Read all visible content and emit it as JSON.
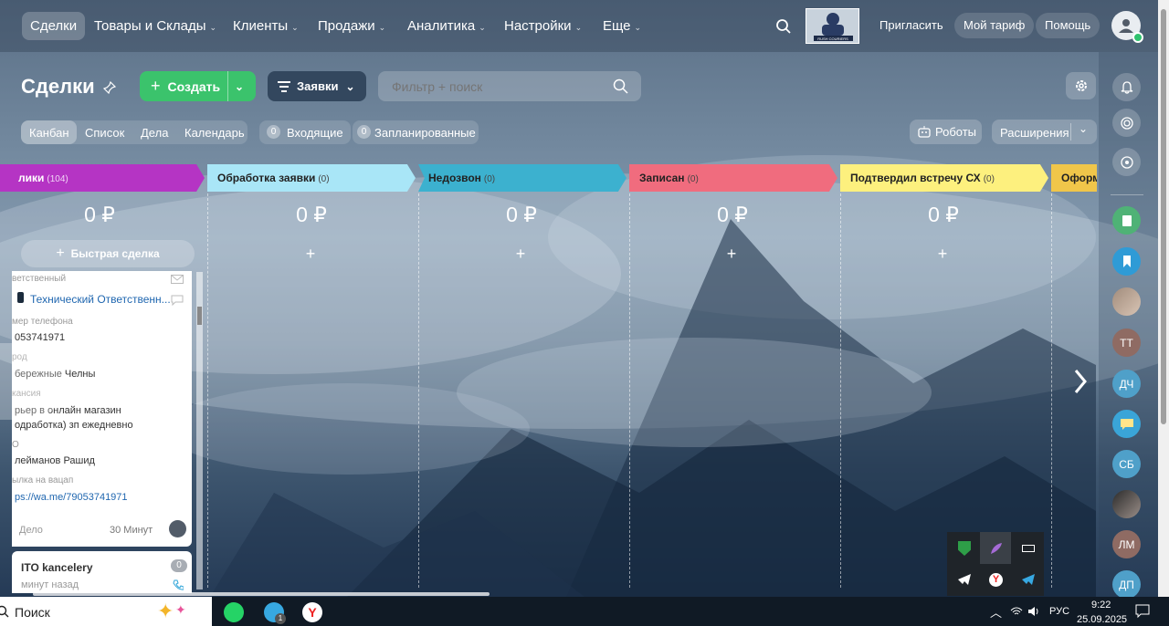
{
  "nav": {
    "items": [
      {
        "label": "Сделки",
        "chevron": ""
      },
      {
        "label": "Товары и Склады",
        "chevron": "⌄"
      },
      {
        "label": "Клиенты",
        "chevron": "⌄"
      },
      {
        "label": "Продажи",
        "chevron": "⌄"
      },
      {
        "label": "Аналитика",
        "chevron": "⌄"
      },
      {
        "label": "Настройки",
        "chevron": "⌄"
      },
      {
        "label": "Еще",
        "chevron": "⌄"
      }
    ],
    "invite": "Пригласить",
    "tariff": "Мой тариф",
    "help": "Помощь",
    "logo_text": "RUSH COURIERS"
  },
  "toolbar": {
    "title": "Сделки",
    "create_label": "Создать",
    "requests_label": "Заявки",
    "search_placeholder": "Фильтр + поиск",
    "robots_label": "Роботы",
    "extensions_label": "Расширения"
  },
  "views": {
    "tabs": [
      "Канбан",
      "Список",
      "Дела",
      "Календарь"
    ],
    "incoming_count": "0",
    "incoming_label": "Входящие",
    "planned_count": "0",
    "planned_label": "Запланированные"
  },
  "columns": [
    {
      "name": "лики",
      "count": "(104)",
      "sum": "0 ₽",
      "color": "#b534c4"
    },
    {
      "name": "Обработка заявки",
      "count": "(0)",
      "sum": "0 ₽",
      "color": "#a9e6f7"
    },
    {
      "name": "Недозвон",
      "count": "(0)",
      "sum": "0 ₽",
      "color": "#3cb1cf"
    },
    {
      "name": "Записан",
      "count": "(0)",
      "sum": "0 ₽",
      "color": "#f06c7e"
    },
    {
      "name": "Подтвердил встречу СХ",
      "count": "(0)",
      "sum": "0 ₽",
      "color": "#fdf07e"
    },
    {
      "name": "Оформ",
      "count": "",
      "sum": "",
      "color": "#f0c64a"
    }
  ],
  "quick_deal": "Быстрая сделка",
  "card": {
    "responsible_label": "ветственный",
    "responsible": "Технический Ответственн...",
    "phone_label": "мер телефона",
    "phone": "053741971",
    "city_label": "род",
    "city": "бережные Челны",
    "vacancy_label": "кансия",
    "vacancy_1": "рьер в онлайн магазин",
    "vacancy_2": "одработка) зп ежедневно",
    "fio_label": "О",
    "fio": "лейманов Рашид",
    "wa_label": "ылка на вацап",
    "wa_link": "ps://wa.me/79053741971",
    "task_label": "Дело",
    "task_time": "30 Минут"
  },
  "card2": {
    "title": "ITO kancelery",
    "time": "минут назад",
    "badge": "0"
  },
  "right_sidebar": {
    "avatars": [
      "ТТ",
      "ДЧ",
      "СБ",
      "ЛМ",
      "ДП"
    ]
  },
  "tray": {
    "lang": "РУС",
    "time": "9:22",
    "date": "25.09.2025"
  },
  "taskbar": {
    "search": "Поиск",
    "telegram_badge": "1"
  }
}
